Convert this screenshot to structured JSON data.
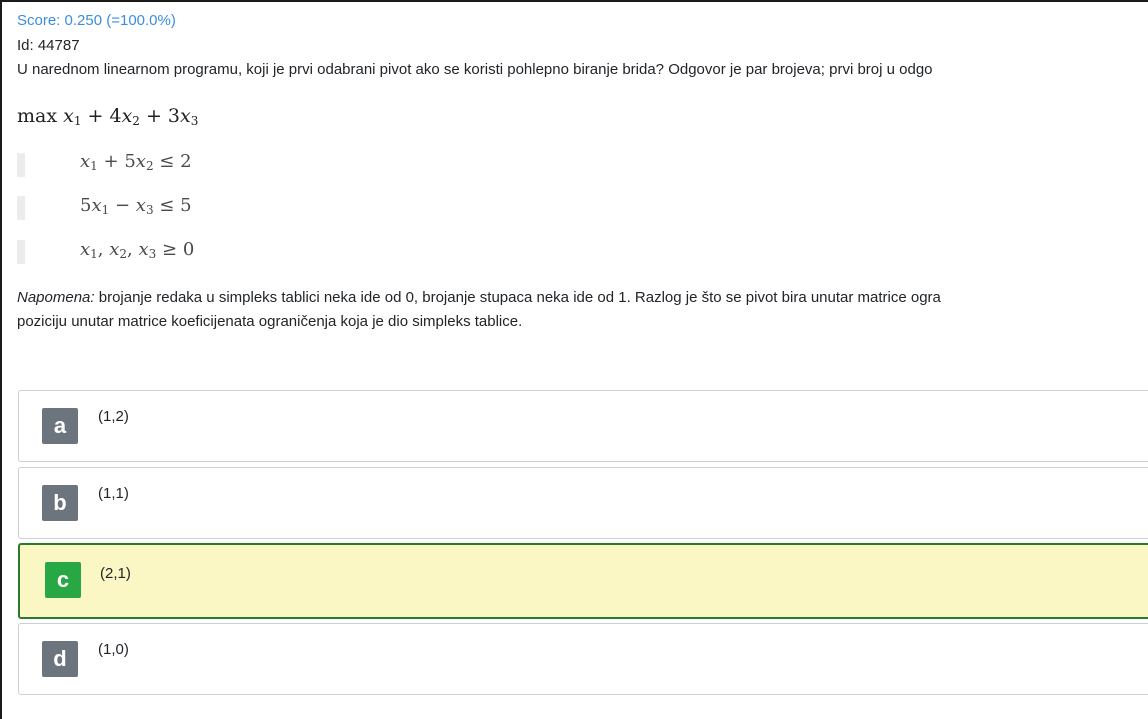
{
  "header": {
    "score": "Score: 0.250 (=100.0%)",
    "id": "Id: 44787"
  },
  "question": {
    "text": "U narednom linearnom programu, koji je prvi odabrani pivot ako se koristi pohlepno biranje brida? Odgovor je par brojeva; prvi broj u odgo"
  },
  "lp": {
    "objective": "max x1 + 4x2 + 3x3",
    "constraints": [
      "x1 + 5x2 ≤ 2",
      "5x1 − x3 ≤ 5",
      "x1, x2, x3 ≥ 0"
    ]
  },
  "note": {
    "label": "Napomena:",
    "line1": "brojanje redaka u simpleks tablici neka ide od 0, brojanje stupaca neka ide od 1. Razlog je što se pivot bira unutar matrice ogra",
    "line2": "poziciju unutar matrice koeficijenata ograničenja koja je dio simpleks tablice."
  },
  "answers": [
    {
      "letter": "a",
      "text": "(1,2)",
      "selected": false
    },
    {
      "letter": "b",
      "text": "(1,1)",
      "selected": false
    },
    {
      "letter": "c",
      "text": "(2,1)",
      "selected": true
    },
    {
      "letter": "d",
      "text": "(1,0)",
      "selected": false
    }
  ],
  "colors": {
    "score": "#3b8ede",
    "selected_bg": "#fbf7c4",
    "selected_border": "#2c7a2c",
    "selected_badge": "#28a745",
    "badge": "#6c757d"
  }
}
